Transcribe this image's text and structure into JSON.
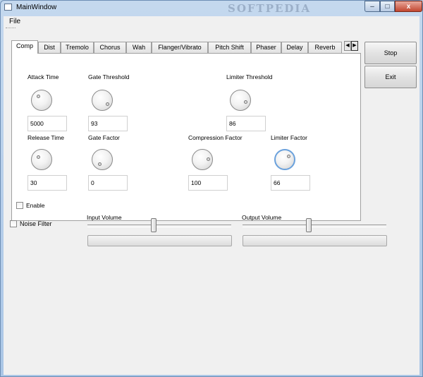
{
  "window": {
    "title": "MainWindow",
    "watermark": "SOFTPEDIA",
    "controls": {
      "minimize": "–",
      "maximize": "□",
      "close": "x"
    }
  },
  "menubar": {
    "file": "File"
  },
  "tabs": {
    "items": [
      "Comp",
      "Dist",
      "Tremolo",
      "Chorus",
      "Wah",
      "Flanger/Vibrato",
      "Pitch Shift",
      "Phaser",
      "Delay",
      "Reverb"
    ],
    "active": "Comp",
    "scroll_left": "◀",
    "scroll_right": "▶"
  },
  "comp": {
    "attack_time": {
      "label": "Attack Time",
      "value": "5000"
    },
    "gate_threshold": {
      "label": "Gate Threshold",
      "value": "93"
    },
    "limiter_threshold": {
      "label": "Limiter Threshold",
      "value": "86"
    },
    "release_time": {
      "label": "Release Time",
      "value": "30"
    },
    "gate_factor": {
      "label": "Gate Factor",
      "value": "0"
    },
    "compression_factor": {
      "label": "Compression Factor",
      "value": "100"
    },
    "limiter_factor": {
      "label": "Limiter Factor",
      "value": "66"
    },
    "enable": {
      "label": "Enable",
      "checked": false
    }
  },
  "noise_filter": {
    "label": "Noise Filter",
    "checked": false
  },
  "input_volume": {
    "label": "Input Volume",
    "level": 0.46,
    "meter_level": 0
  },
  "output_volume": {
    "label": "Output Volume",
    "level": 0.46,
    "meter_level": 0
  },
  "buttons": {
    "stop": "Stop",
    "exit": "Exit"
  },
  "colors": {
    "focus_ring": "#6aa1dc",
    "title_bar": "#b9d1ea",
    "close_button": "#c2462f"
  }
}
